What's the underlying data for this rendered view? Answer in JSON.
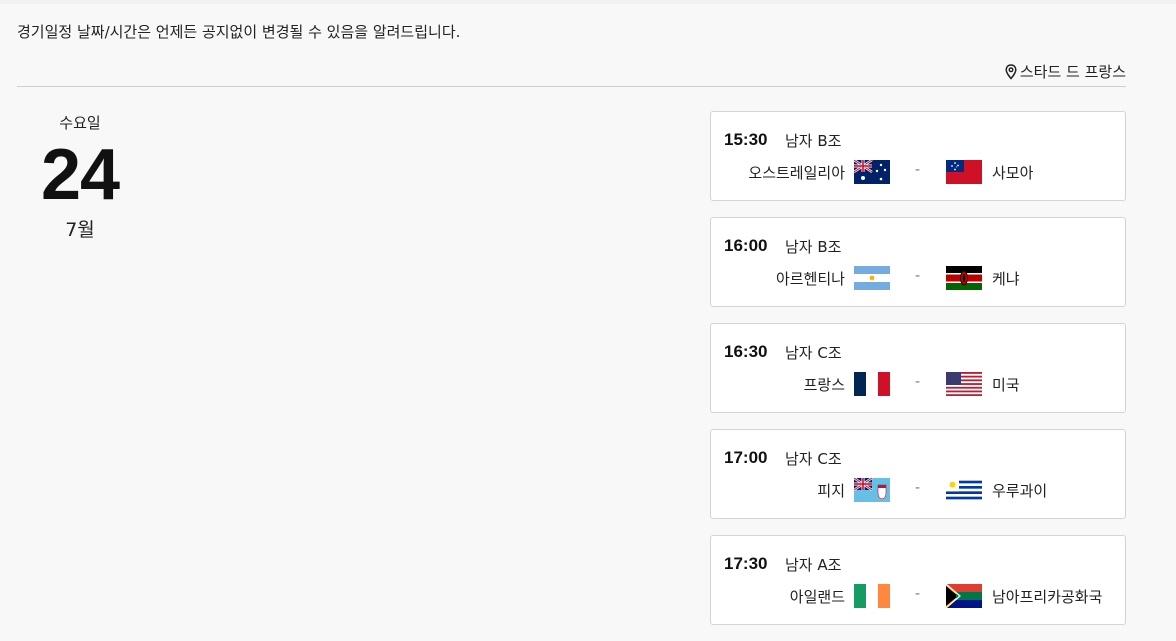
{
  "notice": "경기일정 날짜/시간은 언제든 공지없이 변경될 수 있음을 알려드립니다.",
  "venue": "스타드 드 프랑스",
  "date": {
    "weekday": "수요일",
    "day": "24",
    "month": "7월"
  },
  "matches": [
    {
      "time": "15:30",
      "group": "남자 B조",
      "home": "오스트레일리아",
      "home_flag": "australia-flag",
      "separator": "-",
      "away": "사모아",
      "away_flag": "samoa-flag"
    },
    {
      "time": "16:00",
      "group": "남자 B조",
      "home": "아르헨티나",
      "home_flag": "argentina-flag",
      "separator": "-",
      "away": "케냐",
      "away_flag": "kenya-flag"
    },
    {
      "time": "16:30",
      "group": "남자 C조",
      "home": "프랑스",
      "home_flag": "france-flag",
      "separator": "-",
      "away": "미국",
      "away_flag": "usa-flag"
    },
    {
      "time": "17:00",
      "group": "남자 C조",
      "home": "피지",
      "home_flag": "fiji-flag",
      "separator": "-",
      "away": "우루과이",
      "away_flag": "uruguay-flag"
    },
    {
      "time": "17:30",
      "group": "남자 A조",
      "home": "아일랜드",
      "home_flag": "ireland-flag",
      "separator": "-",
      "away": "남아프리카공화국",
      "away_flag": "south-africa-flag"
    }
  ]
}
